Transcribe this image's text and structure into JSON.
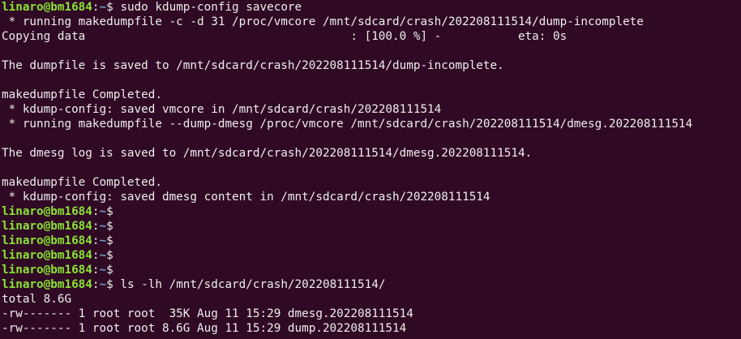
{
  "terminal": {
    "prompt_user_host": "linaro@bm1684",
    "prompt_sep": ":",
    "prompt_path": "~",
    "prompt_dollar": "$",
    "lines": [
      {
        "type": "prompt",
        "cmd": " sudo kdump-config savecore"
      },
      {
        "type": "out",
        "text": " * running makedumpfile -c -d 31 /proc/vmcore /mnt/sdcard/crash/202208111514/dump-incomplete"
      },
      {
        "type": "out",
        "text": "Copying data                                      : [100.0 %] -           eta: 0s"
      },
      {
        "type": "out",
        "text": ""
      },
      {
        "type": "out",
        "text": "The dumpfile is saved to /mnt/sdcard/crash/202208111514/dump-incomplete."
      },
      {
        "type": "out",
        "text": ""
      },
      {
        "type": "out",
        "text": "makedumpfile Completed."
      },
      {
        "type": "out",
        "text": " * kdump-config: saved vmcore in /mnt/sdcard/crash/202208111514"
      },
      {
        "type": "out",
        "text": " * running makedumpfile --dump-dmesg /proc/vmcore /mnt/sdcard/crash/202208111514/dmesg.202208111514"
      },
      {
        "type": "out",
        "text": ""
      },
      {
        "type": "out",
        "text": "The dmesg log is saved to /mnt/sdcard/crash/202208111514/dmesg.202208111514."
      },
      {
        "type": "out",
        "text": ""
      },
      {
        "type": "out",
        "text": "makedumpfile Completed."
      },
      {
        "type": "out",
        "text": " * kdump-config: saved dmesg content in /mnt/sdcard/crash/202208111514"
      },
      {
        "type": "prompt",
        "cmd": ""
      },
      {
        "type": "prompt",
        "cmd": ""
      },
      {
        "type": "prompt",
        "cmd": ""
      },
      {
        "type": "prompt",
        "cmd": ""
      },
      {
        "type": "prompt",
        "cmd": ""
      },
      {
        "type": "prompt",
        "cmd": " ls -lh /mnt/sdcard/crash/202208111514/"
      },
      {
        "type": "out",
        "text": "total 8.6G"
      },
      {
        "type": "out",
        "text": "-rw------- 1 root root  35K Aug 11 15:29 dmesg.202208111514"
      },
      {
        "type": "out",
        "text": "-rw------- 1 root root 8.6G Aug 11 15:29 dump.202208111514"
      }
    ]
  },
  "colors": {
    "background": "#300a24",
    "user_host": "#8ae234",
    "path": "#729fcf",
    "text": "#eeeeec"
  }
}
